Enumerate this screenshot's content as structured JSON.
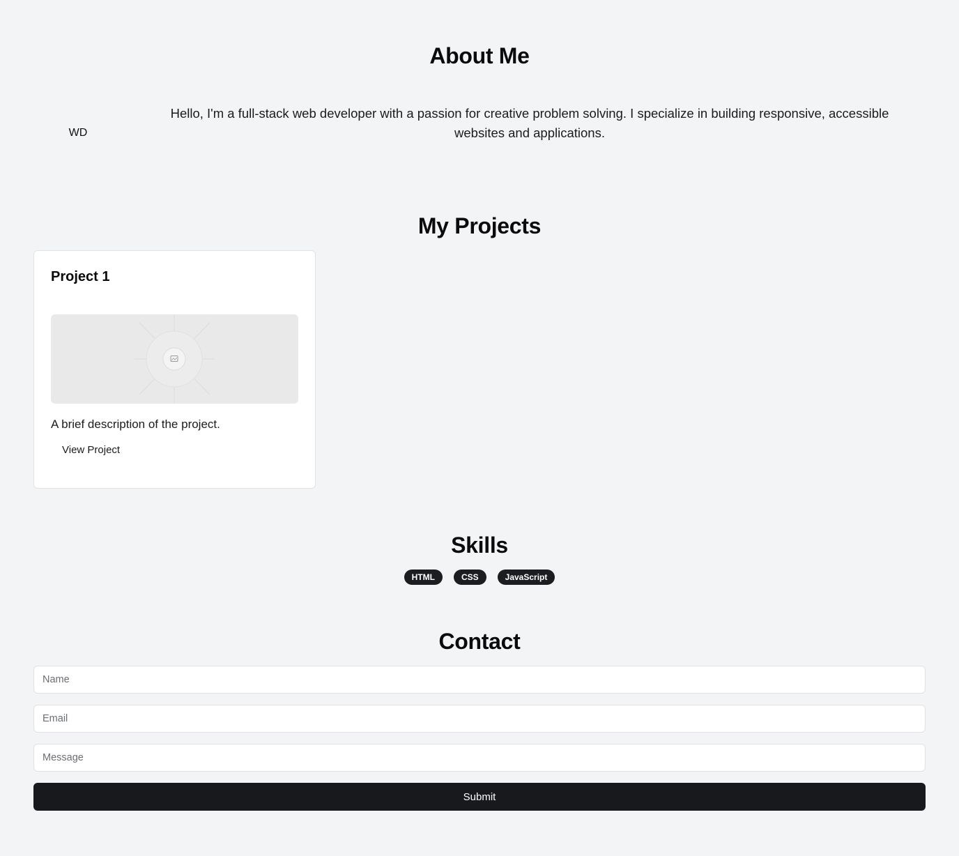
{
  "about": {
    "title": "About Me",
    "avatar_initials": "WD",
    "bio": "Hello, I'm a full-stack web developer with a passion for creative problem solving. I specialize in building responsive, accessible websites and applications."
  },
  "projects": {
    "title": "My Projects",
    "items": [
      {
        "title": "Project 1",
        "image_icon": "image-placeholder-icon",
        "description": "A brief description of the project.",
        "link_label": "View Project"
      }
    ]
  },
  "skills": {
    "title": "Skills",
    "tags": [
      "HTML",
      "CSS",
      "JavaScript"
    ]
  },
  "contact": {
    "title": "Contact",
    "name_placeholder": "Name",
    "email_placeholder": "Email",
    "message_placeholder": "Message",
    "submit_label": "Submit"
  },
  "colors": {
    "background": "#f3f4f6",
    "card": "#ffffff",
    "dark": "#18191c"
  }
}
